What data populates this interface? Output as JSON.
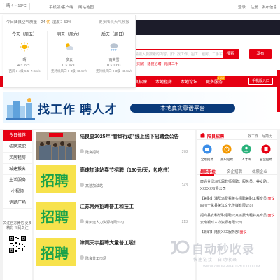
{
  "topbar": {
    "weather": "晴 4 ~ 19°C",
    "links": [
      "手机版/客户端",
      "网站地图"
    ],
    "right": [
      "登录",
      "注册",
      "发布信息"
    ]
  },
  "weather": {
    "aq_label": "今日陆良空气质量：24",
    "aq_level": "优",
    "humidity": "湿度：59%",
    "link": "更多陆良天气预报",
    "days": [
      {
        "name": "今天（周五）",
        "cond": "晴",
        "temp": "4 ~ 19°C",
        "wind": "西风 3-4级 5.5~7.9m/s"
      },
      {
        "name": "明天（周六）",
        "cond": "多云",
        "temp": "0 ~ 16°C",
        "wind": "无持续风向 0-3级 <3.4m/s"
      },
      {
        "name": "后天（周日）",
        "cond": "雨夹雪",
        "temp": "0 ~ 10°C",
        "wind": "无持续风向 0-3级 <3.4m/s"
      }
    ]
  },
  "header": {
    "dark_text": "",
    "search_placeholder": "请输入要搜索的内容，如：找工作、招工、租房、二手车",
    "search_button": "搜索",
    "post_button": "发布",
    "sub_links": "陆良同城 · 陆良招聘 · 陆良二手"
  },
  "nav": {
    "items": [
      "陆良招聘",
      "本地租房",
      "本地论坛",
      "更多服务"
    ],
    "hot": "HOT",
    "right_button": "手机版入口"
  },
  "banner": {
    "title": "找工作  聘人才",
    "pill": "本地真实靠谱平台"
  },
  "categories": [
    "今日推荐",
    "招聘求职",
    "买房租房",
    "城建报名",
    "生活服务",
    "小视频",
    "话题广场"
  ],
  "qr": {
    "text": "关注官方微信 更多精彩 扫码关注"
  },
  "articles": [
    {
      "title": "陆良县2025年“春风行动”线上线下招聘会公告",
      "source": "陆良招聘",
      "views": "378",
      "thumb": "crowd"
    },
    {
      "title": "高速加油站春节招聘（190元/天，包吃住）",
      "source": "高速加油站",
      "views": "243",
      "thumb": "zhaopin"
    },
    {
      "title": "江苏常州招聘普工和技工",
      "source": "常州运人力资源有限公司",
      "views": "213",
      "thumb": "zhaopin"
    },
    {
      "title": "津栗天宇招聘大量普工啦！",
      "source": "陆良普工市场",
      "views": "",
      "thumb": "zhaopin"
    }
  ],
  "right": {
    "title": "陆良招聘",
    "links": [
      "找工作",
      "写简历"
    ],
    "icons": [
      "全职招聘",
      "兼职招聘",
      "人才库",
      "名企招聘"
    ],
    "tabs": [
      "最新职位",
      "名企招聘",
      "优质企业"
    ],
    "jobs": [
      {
        "text": "康通业绿洲乐器教师招聘：服务员、美女助...",
        "pay": ""
      },
      {
        "text": "XXXXX有限公司",
        "pay": ""
      },
      {
        "text": "【兼职】涌群派费看鱼头招聘兼职工程专员",
        "pay": "面议"
      },
      {
        "text": "四川宁化县荣江文化传媒有限公司",
        "pay": ""
      },
      {
        "text": "招商县农科帮职招聘公寓派费出租补充专员",
        "pay": "面议"
      },
      {
        "text": "云南银时人力资源有限公司",
        "pay": ""
      },
      {
        "text": "【兼职】陆良XXX服务部",
        "pay": "面议"
      }
    ]
  },
  "watermark": {
    "big": "自动秒收录",
    "sub": "快速链接—自动收录",
    "url": "WWW.ZIDONGMIAOSHOULU.COM"
  },
  "colors": {
    "brand": "#e60012",
    "banner_blue": "#0a3a7a",
    "accent_orange": "#f39800"
  }
}
